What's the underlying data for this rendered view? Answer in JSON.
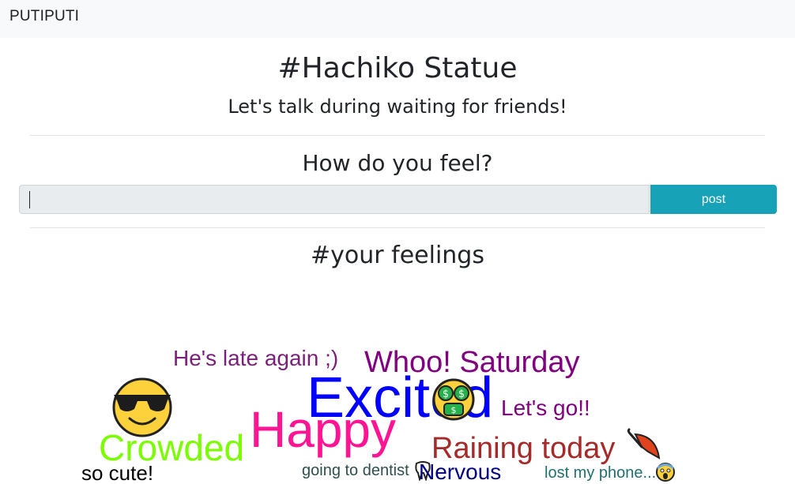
{
  "navbar": {
    "brand": "PUTIPUTI"
  },
  "header": {
    "title": "#Hachiko Statue",
    "subtitle": "Let's talk during waiting for friends!"
  },
  "form": {
    "prompt": "How do you feel?",
    "input_value": "",
    "post_label": "post"
  },
  "feelings": {
    "title": "#your feelings",
    "words": [
      {
        "text": "He's late again ;)",
        "color": "#7a1f7a"
      },
      {
        "text": "Whoo! Saturday",
        "color": "#800080"
      },
      {
        "text": "Excited",
        "color": "#0000ff"
      },
      {
        "text": "Let's go!!",
        "color": "#800080"
      },
      {
        "text": "Happy",
        "color": "#ff1493"
      },
      {
        "text": "Crowded",
        "color": "#7cfc00"
      },
      {
        "text": "Raining today",
        "color": "#a52a2a"
      },
      {
        "text": "so cute!",
        "color": "#000000"
      },
      {
        "text": "going to dentist",
        "color": "#2f4f4f"
      },
      {
        "text": "Nervous",
        "color": "#000080"
      },
      {
        "text": "lost my phone...",
        "color": "#20706e"
      }
    ],
    "icons": [
      "sunglasses-face-icon",
      "money-mouth-face-icon",
      "umbrella-icon",
      "tooth-icon",
      "screaming-face-icon"
    ]
  },
  "colors": {
    "navbar_bg": "#f8f9fa",
    "post_button": "#17a2b8",
    "input_bg": "#e9ecef"
  }
}
